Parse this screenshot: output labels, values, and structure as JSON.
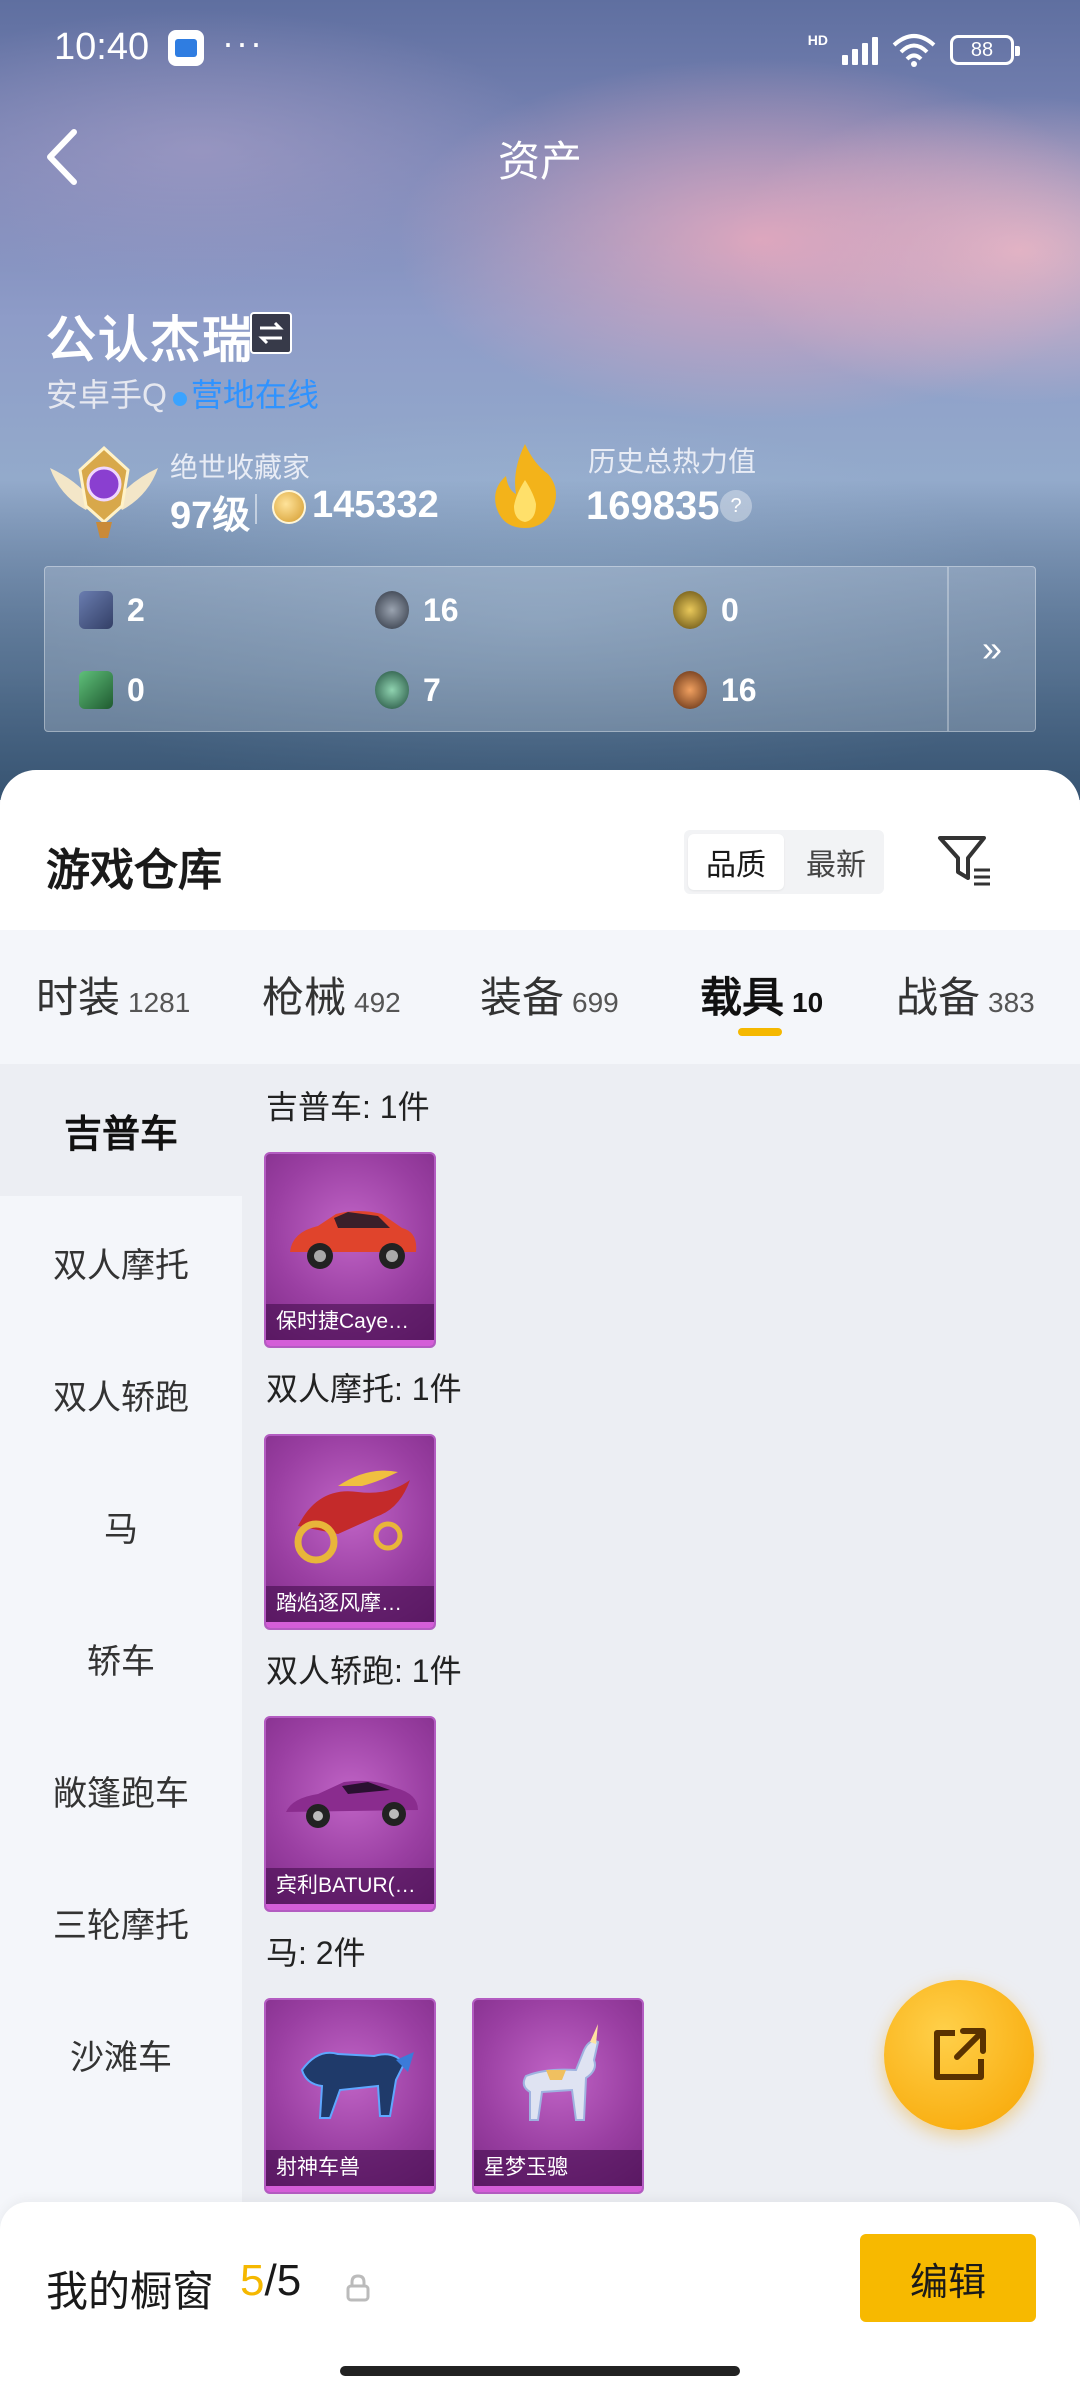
{
  "status_bar": {
    "time": "10:40",
    "dots": "···",
    "network": "HD",
    "battery": "88"
  },
  "nav": {
    "title": "资产"
  },
  "profile": {
    "name": "公认杰瑞",
    "platform": "安卓手Q",
    "presence": "营地在线",
    "collector_title": "绝世收藏家",
    "level": "97级",
    "coins": "145332",
    "heat_title": "历史总热力值",
    "heat_value": "169835",
    "help": "?"
  },
  "stats": [
    {
      "value": "2",
      "icon": "card-icon",
      "color": "#4a5d8c"
    },
    {
      "value": "16",
      "icon": "dark-coin-icon",
      "color": "#3a4350"
    },
    {
      "value": "0",
      "icon": "gold-coin-icon",
      "color": "#7a6520"
    },
    {
      "value": "0",
      "icon": "green-card-icon",
      "color": "#3a8a4a"
    },
    {
      "value": "7",
      "icon": "green-orb-icon",
      "color": "#2f6b55"
    },
    {
      "value": "16",
      "icon": "bronze-orb-icon",
      "color": "#8a4a20"
    }
  ],
  "stats_more": "»",
  "warehouse": {
    "title": "游戏仓库",
    "sort": [
      "品质",
      "最新"
    ],
    "tabs": [
      {
        "label": "时装",
        "count": "1281"
      },
      {
        "label": "枪械",
        "count": "492"
      },
      {
        "label": "装备",
        "count": "699"
      },
      {
        "label": "载具",
        "count": "10"
      },
      {
        "label": "战备",
        "count": "383"
      }
    ],
    "categories": [
      "吉普车",
      "双人摩托",
      "双人轿跑",
      "马",
      "轿车",
      "敞篷跑车",
      "三轮摩托",
      "沙滩车"
    ],
    "groups": [
      {
        "title": "吉普车: 1件",
        "items": [
          "保时捷Caye…"
        ]
      },
      {
        "title": "双人摩托: 1件",
        "items": [
          "踏焰逐风摩…"
        ]
      },
      {
        "title": "双人轿跑: 1件",
        "items": [
          "宾利BATUR(…"
        ]
      },
      {
        "title": "马: 2件",
        "items": [
          "射神车兽",
          "星梦玉骢"
        ]
      }
    ]
  },
  "showcase": {
    "label": "我的橱窗",
    "current": "5",
    "total": "/5",
    "edit": "编辑"
  },
  "colors": {
    "accent": "#f7b900",
    "online": "#2f93ff",
    "card": "#9a3fa2"
  }
}
